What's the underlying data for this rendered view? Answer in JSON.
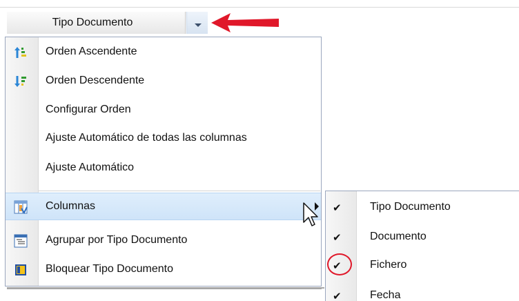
{
  "header": {
    "column_title": "Tipo Documento",
    "dropdown_icon": "chevron-down-icon",
    "annotation_color": "#e0182a"
  },
  "menu": {
    "items": [
      {
        "label": "Orden Ascendente",
        "icon": "sort-ascending-icon"
      },
      {
        "label": "Orden Descendente",
        "icon": "sort-descending-icon"
      },
      {
        "label": "Configurar Orden",
        "icon": ""
      },
      {
        "label": "Ajuste Automático de todas las columnas",
        "icon": ""
      },
      {
        "label": "Ajuste Automático",
        "icon": ""
      },
      {
        "label": "Columnas",
        "icon": "columns-chooser-icon",
        "has_submenu": true,
        "highlighted": true
      },
      {
        "label": "Agrupar por Tipo Documento",
        "icon": "group-by-icon"
      },
      {
        "label": "Bloquear Tipo Documento",
        "icon": "freeze-column-icon"
      }
    ]
  },
  "submenu": {
    "items": [
      {
        "label": "Tipo Documento",
        "checked": true
      },
      {
        "label": "Documento",
        "checked": true
      },
      {
        "label": "Fichero",
        "checked": true,
        "circled": true
      },
      {
        "label": "Fecha",
        "checked": true
      }
    ],
    "check_glyph": "✔"
  }
}
